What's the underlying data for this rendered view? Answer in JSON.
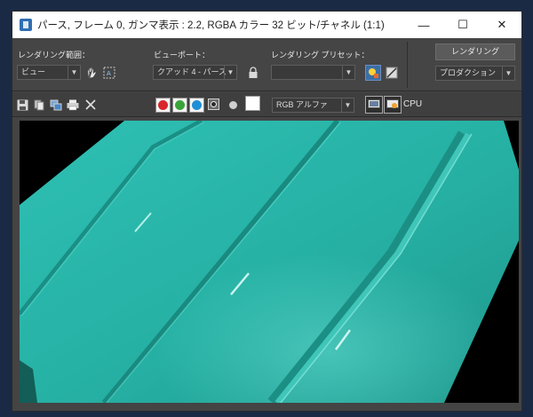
{
  "window": {
    "title": "パース, フレーム 0, ガンマ表示 : 2.2, RGBA カラー 32 ビット/チャネル (1:1)",
    "minimize_glyph": "—",
    "maximize_glyph": "☐",
    "close_glyph": "✕"
  },
  "panel": {
    "render_area_label": "レンダリング範囲：",
    "render_area_value": "ビュー",
    "viewport_label": "ビューポート：",
    "viewport_value": "クアッド 4 - パース",
    "preset_label": "レンダリング プリセット：",
    "preset_value": "",
    "render_button": "レンダリング",
    "production_value": "プロダクション"
  },
  "toolbar": {
    "display_mode": "RGB アルファ",
    "cpu_label": "CPU",
    "channel_colors": {
      "red": "#d8262c",
      "green": "#3aa43a",
      "blue": "#1f8fd6"
    }
  },
  "render": {
    "surface_color": "#2bb3a7",
    "background": "#000000"
  }
}
